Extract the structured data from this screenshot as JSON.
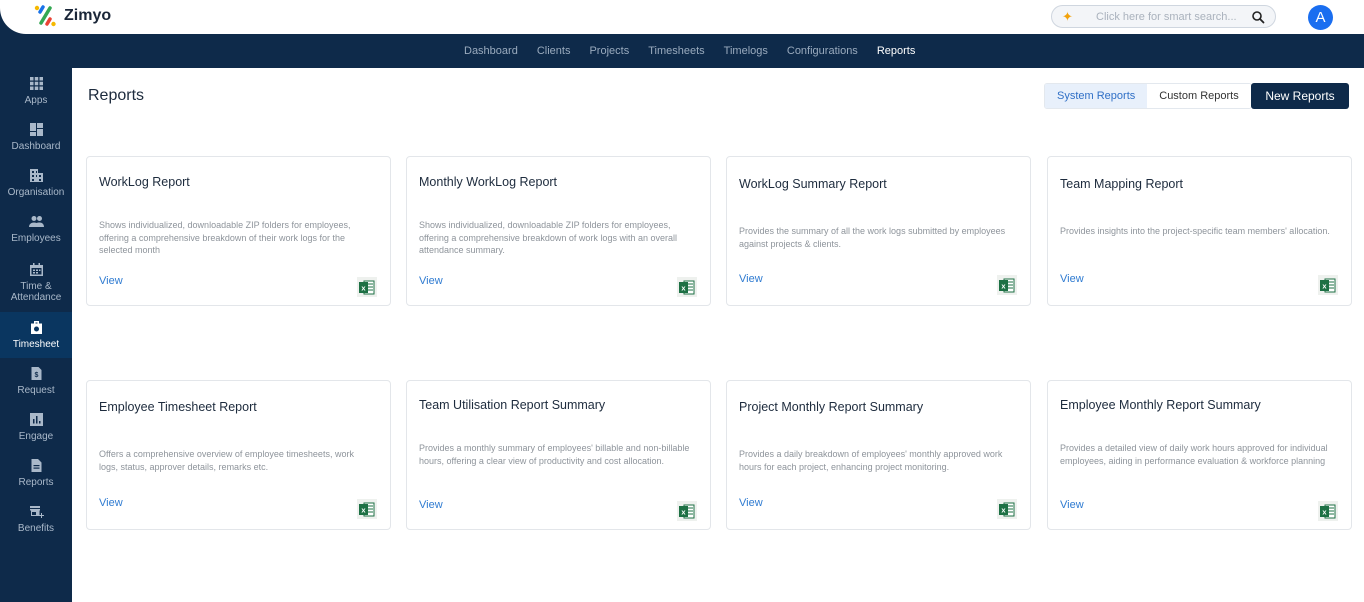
{
  "app": {
    "name": "Zimyo",
    "avatar_initial": "A"
  },
  "search": {
    "placeholder": "Click here for smart search..."
  },
  "topnav": {
    "items": [
      {
        "label": "Dashboard",
        "active": false
      },
      {
        "label": "Clients",
        "active": false
      },
      {
        "label": "Projects",
        "active": false
      },
      {
        "label": "Timesheets",
        "active": false
      },
      {
        "label": "Timelogs",
        "active": false
      },
      {
        "label": "Configurations",
        "active": false
      },
      {
        "label": "Reports",
        "active": true
      }
    ]
  },
  "sidebar": {
    "items": [
      {
        "label": "Apps",
        "icon": "apps-grid-icon"
      },
      {
        "label": "Dashboard",
        "icon": "dashboard-icon"
      },
      {
        "label": "Organisation",
        "icon": "building-icon"
      },
      {
        "label": "Employees",
        "icon": "people-icon"
      },
      {
        "label": "Time & Attendance",
        "icon": "calendar-icon"
      },
      {
        "label": "Timesheet",
        "icon": "timesheet-bag-icon",
        "active": true
      },
      {
        "label": "Request",
        "icon": "request-dollar-icon"
      },
      {
        "label": "Engage",
        "icon": "bar-chart-icon"
      },
      {
        "label": "Reports",
        "icon": "document-icon"
      },
      {
        "label": "Benefits",
        "icon": "store-plus-icon"
      }
    ]
  },
  "page": {
    "title": "Reports",
    "toggle": {
      "system": "System Reports",
      "custom": "Custom Reports",
      "selected": "System Reports"
    },
    "new_button": "New Reports"
  },
  "cards": [
    {
      "title": "WorkLog Report",
      "description": "Shows individualized, downloadable ZIP folders for employees, offering a comprehensive breakdown of their work logs for the selected month",
      "link": "View"
    },
    {
      "title": "Monthly WorkLog Report",
      "description": "Shows individualized, downloadable ZIP folders for employees, offering a comprehensive breakdown of work logs with an overall attendance summary.",
      "link": "View"
    },
    {
      "title": "WorkLog Summary Report",
      "description": "Provides the summary of all the work logs submitted by employees against projects & clients.",
      "link": "View"
    },
    {
      "title": "Team Mapping Report",
      "description": "Provides insights into the project-specific team members' allocation.",
      "link": "View"
    },
    {
      "title": "Employee Timesheet Report",
      "description": "Offers a comprehensive overview of employee timesheets, work logs, status, approver details, remarks etc.",
      "link": "View"
    },
    {
      "title": "Team Utilisation Report Summary",
      "description": "Provides a monthly summary of employees' billable and non-billable hours, offering a clear view of productivity and cost allocation.",
      "link": "View"
    },
    {
      "title": "Project Monthly Report Summary",
      "description": "Provides a daily breakdown of employees' monthly approved work hours for each project, enhancing project monitoring.",
      "link": "View"
    },
    {
      "title": "Employee Monthly Report Summary",
      "description": "Provides a detailed view of daily work hours approved for individual employees, aiding in performance evaluation & workforce planning",
      "link": "View"
    }
  ],
  "colors": {
    "navy": "#0e2a4a",
    "accent_blue": "#2f7bd1",
    "avatar_blue": "#1a6ef0",
    "excel_green": "#1d7044"
  }
}
